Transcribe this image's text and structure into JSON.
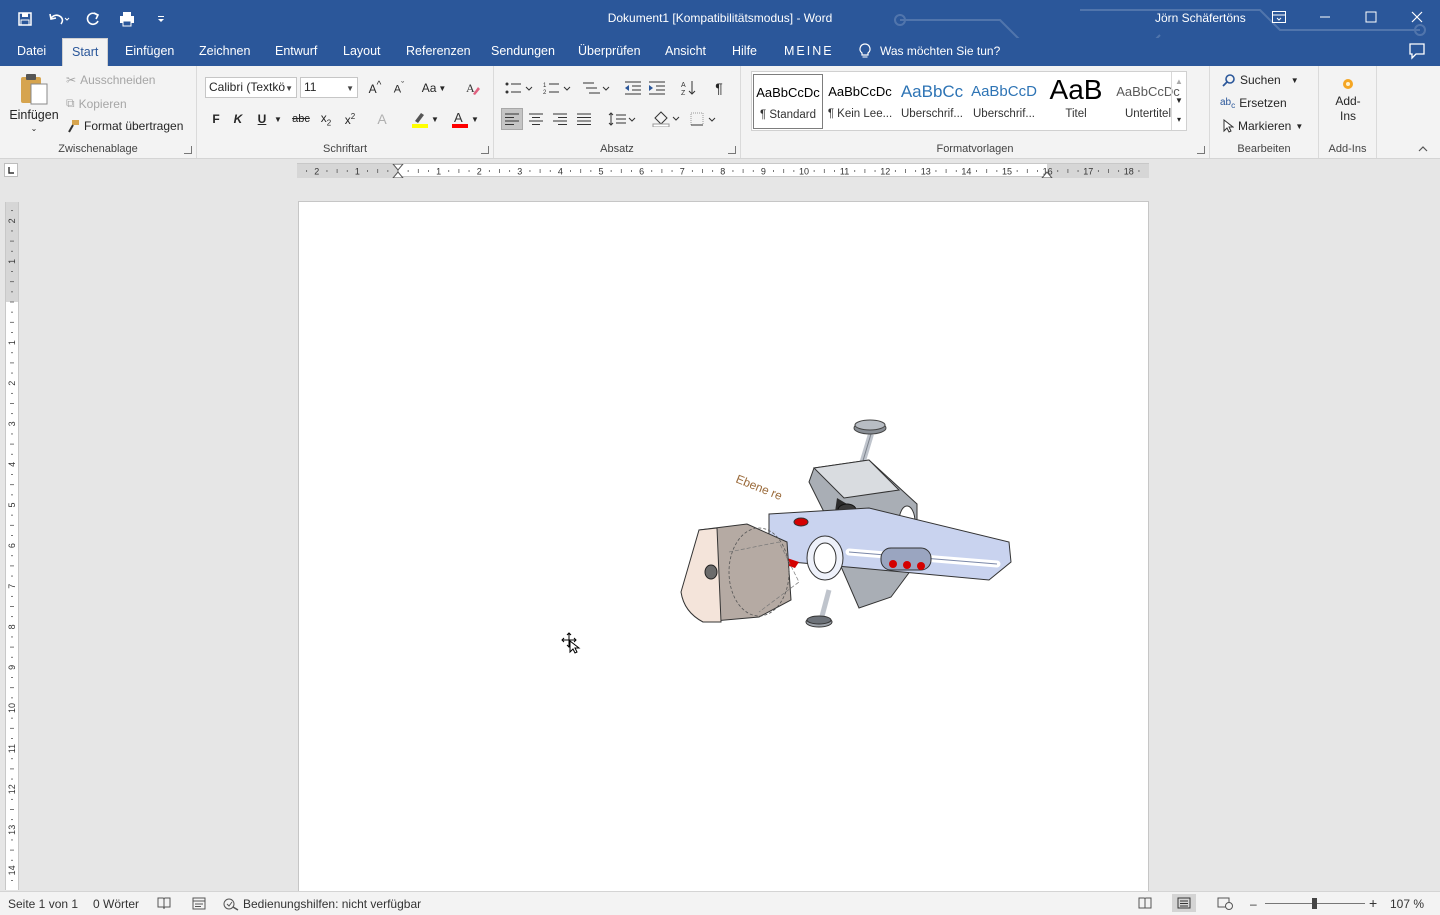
{
  "app": {
    "doc_title": "Dokument1 [Kompatibilitätsmodus]  -  Word",
    "user": "Jörn Schäfertöns"
  },
  "tabs": [
    "Datei",
    "Start",
    "Einfügen",
    "Zeichnen",
    "Entwurf",
    "Layout",
    "Referenzen",
    "Sendungen",
    "Überprüfen",
    "Ansicht",
    "Hilfe",
    "MEINE"
  ],
  "active_tab": "Start",
  "tell_me": "Was möchten Sie tun?",
  "clipboard": {
    "paste": "Einfügen",
    "cut": "Ausschneiden",
    "copy": "Kopieren",
    "format_painter": "Format übertragen",
    "label": "Zwischenablage"
  },
  "font": {
    "name": "Calibri (Textkö",
    "size": "11",
    "label": "Schriftart",
    "bold": "F",
    "italic": "K",
    "underline": "U",
    "strike": "abc",
    "case": "Aa"
  },
  "paragraph": {
    "label": "Absatz"
  },
  "styles": {
    "label": "Formatvorlagen",
    "items": [
      {
        "preview": "AaBbCcDc",
        "name": "¶ Standard"
      },
      {
        "preview": "AaBbCcDc",
        "name": "¶ Kein Lee..."
      },
      {
        "preview": "AaBbCc",
        "name": "Überschrif..."
      },
      {
        "preview": "AaBbCcD",
        "name": "Überschrif..."
      },
      {
        "preview": "AaB",
        "name": "Titel"
      },
      {
        "preview": "AaBbCcDc",
        "name": "Untertitel"
      }
    ]
  },
  "editing": {
    "find": "Suchen",
    "replace": "Ersetzen",
    "select": "Markieren",
    "label": "Bearbeiten"
  },
  "addins": {
    "button": "Add-Ins",
    "label": "Add-Ins"
  },
  "hruler_labels": [
    "2",
    "1",
    "1",
    "2",
    "3",
    "4",
    "5",
    "6",
    "7",
    "8",
    "9",
    "10",
    "11",
    "12",
    "13",
    "14",
    "15",
    "16",
    "17",
    "18"
  ],
  "vruler_labels": [
    "2",
    "1",
    "1",
    "2",
    "3",
    "4",
    "5",
    "6",
    "7",
    "8",
    "9",
    "10",
    "11",
    "12",
    "13",
    "14"
  ],
  "figure_label": "Ebene re",
  "status": {
    "page": "Seite 1 von 1",
    "words": "0 Wörter",
    "accessibility": "Bedienungshilfen: nicht verfügbar",
    "zoom": "107 %"
  },
  "colors": {
    "brand": "#2b579a",
    "highlight": "#ffff00",
    "font_color": "#ff0000"
  }
}
